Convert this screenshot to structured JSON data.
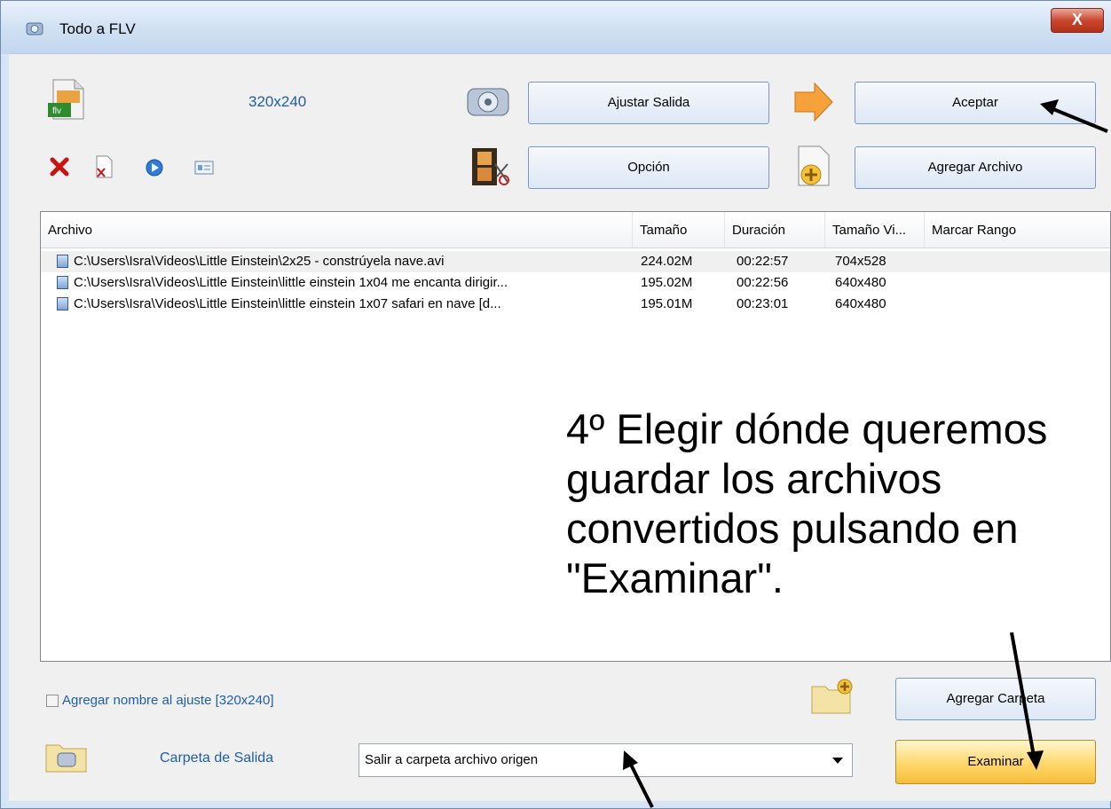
{
  "window": {
    "title": "Todo a FLV",
    "close_label": "X"
  },
  "toolbar": {
    "resolution": "320x240",
    "adjust_output": "Ajustar Salida",
    "accept": "Aceptar",
    "option": "Opción",
    "add_file": "Agregar Archivo",
    "flv_label": "flv"
  },
  "file_list": {
    "columns": [
      "Archivo",
      "Tamaño",
      "Duración",
      "Tamaño Vi...",
      "Marcar Rango"
    ],
    "rows": [
      {
        "file": "C:\\Users\\Isra\\Videos\\Little Einstein\\2x25 - constrúyela nave.avi",
        "size": "224.02M",
        "duration": "00:22:57",
        "video_size": "704x528"
      },
      {
        "file": "C:\\Users\\Isra\\Videos\\Little Einstein\\little einstein 1x04 me encanta dirigir...",
        "size": "195.02M",
        "duration": "00:22:56",
        "video_size": "640x480"
      },
      {
        "file": "C:\\Users\\Isra\\Videos\\Little Einstein\\little einstein 1x07 safari en nave [d...",
        "size": "195.01M",
        "duration": "00:23:01",
        "video_size": "640x480"
      }
    ]
  },
  "annotation": "4º Elegir dónde queremos\nguardar los archivos\nconvertidos pulsando en\n\"Examinar\".",
  "bottom": {
    "add_name_checkbox": "Agregar nombre al ajuste [320x240]",
    "add_folder": "Agregar Carpeta",
    "output_folder_label": "Carpeta de Salida",
    "output_folder_value": "Salir a carpeta archivo origen",
    "browse": "Examinar"
  },
  "colors": {
    "accent_text": "#1f5ea8",
    "browse_button": "#ffd76a",
    "close_button": "#c9462f",
    "delete_icon": "#cc1111"
  },
  "icons": [
    "flv-file-icon",
    "film-reel-icon",
    "orange-arrow-icon",
    "film-cut-icon",
    "add-file-icon",
    "delete-icon",
    "remove-file-icon",
    "play-icon",
    "info-icon",
    "folder-add-icon",
    "folder-icon",
    "video-file-icon"
  ]
}
